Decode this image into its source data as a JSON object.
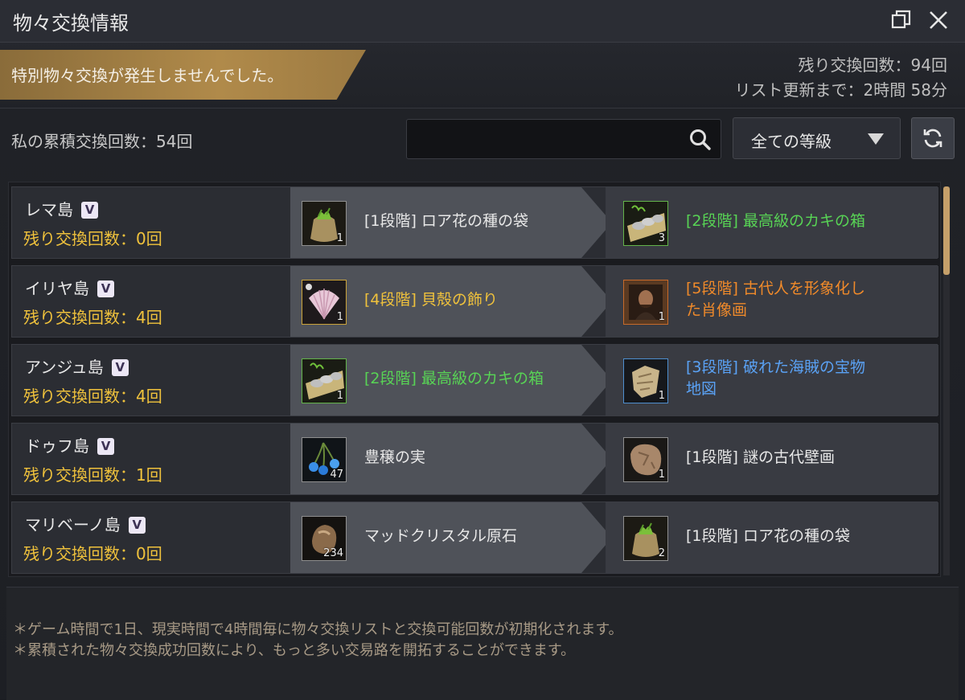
{
  "window": {
    "title": "物々交換情報",
    "restore_icon": "restore-window-icon",
    "close_icon": "close-icon"
  },
  "banner": {
    "text": "特別物々交換が発生しませんでした。"
  },
  "stats": {
    "remaining_exchanges": "残り交換回数：94回",
    "list_refresh": "リスト更新まで：2時間 58分"
  },
  "accumulated": "私の累積交換回数：54回",
  "search": {
    "placeholder": "",
    "icon": "search-icon"
  },
  "grade_filter": {
    "selected": "全ての等級",
    "icon": "chevron-down-icon"
  },
  "refresh_button": {
    "icon": "refresh-icon"
  },
  "rows": [
    {
      "island": "レマ島",
      "badge": "V",
      "remaining": "残り交換回数：0回",
      "give": {
        "name": "[1段階] ロア花の種の袋",
        "qty": "1",
        "icon": "seed-bag-icon",
        "grade_color": "#8f8f8f"
      },
      "get": {
        "name": "[2段階] 最高級のカキの箱",
        "qty": "3",
        "icon": "oyster-box-icon",
        "grade_color": "#63b34a"
      }
    },
    {
      "island": "イリヤ島",
      "badge": "V",
      "remaining": "残り交換回数：4回",
      "give": {
        "name": "[4段階] 貝殻の飾り",
        "qty": "1",
        "icon": "shell-ornament-icon",
        "grade_color": "#c9a23a"
      },
      "get": {
        "name_line1": "[5段階] 古代人を形象化し",
        "name_line2": "た肖像画",
        "qty": "1",
        "icon": "portrait-icon",
        "grade_color": "#c76a2a"
      }
    },
    {
      "island": "アンジュ島",
      "badge": "V",
      "remaining": "残り交換回数：4回",
      "give": {
        "name": "[2段階] 最高級のカキの箱",
        "qty": "1",
        "icon": "oyster-box-icon",
        "grade_color": "#63b34a"
      },
      "get": {
        "name_line1": "[3段階] 破れた海賊の宝物",
        "name_line2": "地図",
        "qty": "1",
        "icon": "treasure-map-icon",
        "grade_color": "#4e8ecf"
      }
    },
    {
      "island": "ドゥフ島",
      "badge": "V",
      "remaining": "残り交換回数：1回",
      "give": {
        "name": "豊穣の実",
        "qty": "47",
        "icon": "fruit-icon",
        "grade_color": "#8f8f8f"
      },
      "get": {
        "name": "[1段階] 謎の古代壁画",
        "qty": "1",
        "icon": "mural-stone-icon",
        "grade_color": "#8f8f8f"
      }
    },
    {
      "island": "マリベーノ島",
      "badge": "V",
      "remaining": "残り交換回数：0回",
      "give": {
        "name": "マッドクリスタル原石",
        "qty": "234",
        "icon": "crystal-ore-icon",
        "grade_color": "#8f8f8f"
      },
      "get": {
        "name": "[1段階] ロア花の種の袋",
        "qty": "2",
        "icon": "seed-bag-icon",
        "grade_color": "#8f8f8f"
      }
    }
  ],
  "notes": [
    "＊ゲーム時間で1日、現実時間で4時間毎に物々交換リストと交換可能回数が初期化されます。",
    "＊累積された物々交換成功回数により、もっと多い交易路を開拓することができます。"
  ]
}
